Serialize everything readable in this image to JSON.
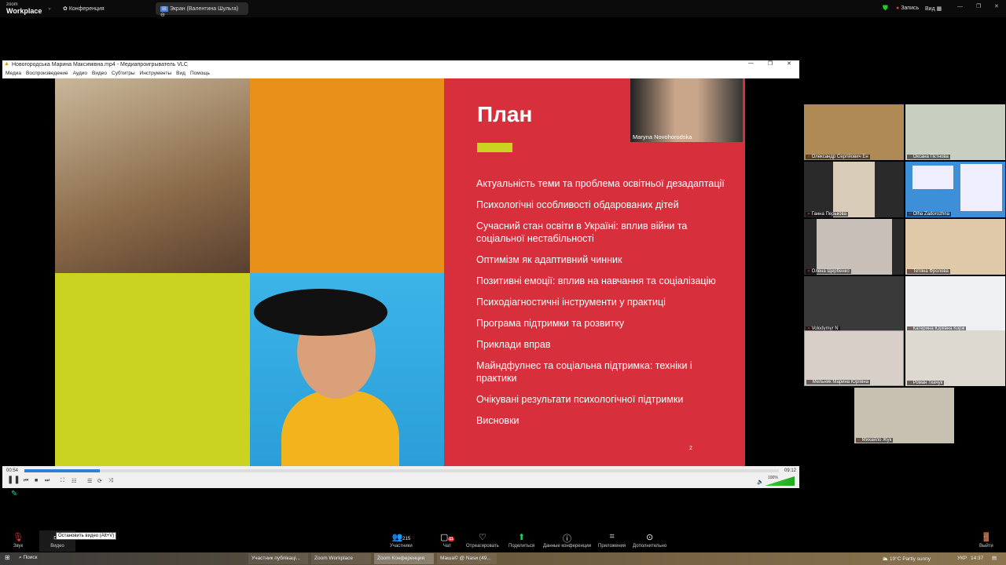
{
  "zoom": {
    "logo_small": "zoom",
    "logo_big": "Workplace",
    "meeting_label": "Конференция",
    "share_label": "Экран (Валентина Шульга)",
    "record_label": "Запись",
    "view_label": "Вид"
  },
  "vlc": {
    "title": "Новогородська Марина Максимівна.mp4 - Медиапроигрыватель VLC",
    "menu": [
      "Медиа",
      "Воспроизведение",
      "Аудио",
      "Видео",
      "Субтитры",
      "Инструменты",
      "Вид",
      "Помощь"
    ],
    "time_elapsed": "00:54",
    "time_total": "09:12",
    "progress_percent": 10,
    "volume": "100%"
  },
  "slide": {
    "title": "План",
    "speaker": "Maryna Novohorodska",
    "items": [
      "Актуальність теми та проблема освітньої дезадаптації",
      "Психологічні особливості обдарованих дітей",
      "Сучасний стан освіти в Україні: вплив війни та соціальної нестабільності",
      "Оптимізм як адаптивний чинник",
      "Позитивні емоції: вплив на навчання та соціалізацію",
      "Психодіагностичні інструменти у практиці",
      "Програма підтримки та розвитку",
      "Приклади вправ",
      "Майндфулнес та соціальна підтримка: техніки і практики",
      "Очікувані результати психологічної підтримки",
      "Висновки"
    ],
    "page": "2",
    "colors": {
      "red": "#d7303c",
      "orange": "#e8901a",
      "lime": "#cbd321"
    }
  },
  "participants": [
    "Олександр Сергійович Ен",
    "Оксана Пєтнова",
    "Ганна Перькова",
    "Olha Zadorozhna",
    "Олена Щербенко",
    "Тетяна Фролова",
    "Volodymyr N",
    "Катерина Юріївна Корж",
    "Мельник Марина Юріївна",
    "Роман Ткачук",
    "Михайло Жук"
  ],
  "toolbar": {
    "audio": "Звук",
    "video": "Видео",
    "tooltip": "Остановить видео (Alt+V)",
    "participants": "Участники",
    "participants_count": "215",
    "chat": "Чат",
    "chat_badge": "11",
    "react": "Отреагировать",
    "share": "Поделиться",
    "info": "Данные конференции",
    "apps": "Приложения",
    "more": "Дополнительно",
    "leave": "Выйти"
  },
  "taskbar": {
    "search": "Поиск",
    "tasks": [
      "Участник публікаці...",
      "Zoom Workplace",
      "Zoom Конференция",
      "Маша© @ Nasи (49..."
    ],
    "weather": "19°C  Partly sunny",
    "lang": "УКР",
    "time": "14:37"
  }
}
